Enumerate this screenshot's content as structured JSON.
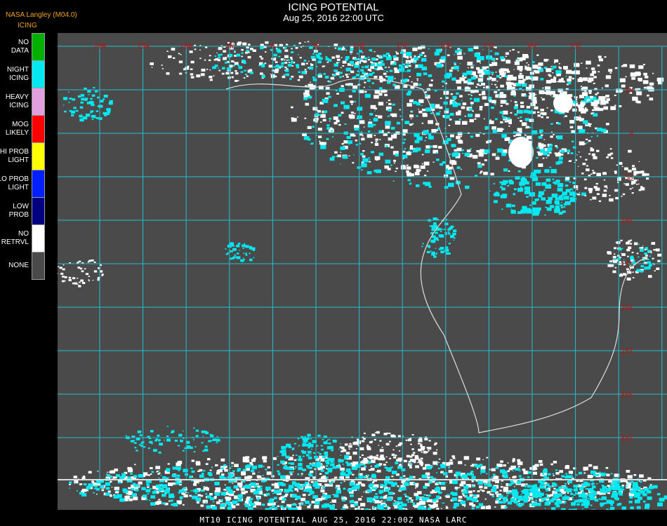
{
  "header": {
    "title": "ICING POTENTIAL",
    "datetime": "Aug 25, 2016 22:00 UTC",
    "org": "NASA Langley (M04.0)",
    "legend_title": "ICING"
  },
  "legend": [
    {
      "label": "NO DATA",
      "color": "#00b000"
    },
    {
      "label": "NIGHT ICING",
      "color": "#00e8f0"
    },
    {
      "label": "HEAVY ICING",
      "color": "#e0a0e0"
    },
    {
      "label": "MOG LIKELY",
      "color": "#ff0000"
    },
    {
      "label": "HI PROB LIGHT",
      "color": "#ffff00"
    },
    {
      "label": "LO PROB LIGHT",
      "color": "#0020ff"
    },
    {
      "label": "LOW PROB",
      "color": "#000080"
    },
    {
      "label": "NO RETRVL",
      "color": "#ffffff"
    },
    {
      "label": "NONE",
      "color": "#4a4a4a"
    }
  ],
  "map": {
    "background_color": "#4a4a4a",
    "grid_color": "#20c0d0",
    "label_color": "#c01010",
    "lon_labels": [
      "20W",
      "15W",
      "10W",
      "5W",
      "0",
      "5E",
      "10E",
      "15E",
      "20E",
      "25E",
      "30E",
      "35E"
    ],
    "lat_labels": [
      "5N",
      "0",
      "5S",
      "10S",
      "15S",
      "20S",
      "25S",
      "30S",
      "35S"
    ]
  },
  "footer": "MT10  ICING POTENTIAL   AUG 25, 2016 22:00Z   NASA LARC"
}
